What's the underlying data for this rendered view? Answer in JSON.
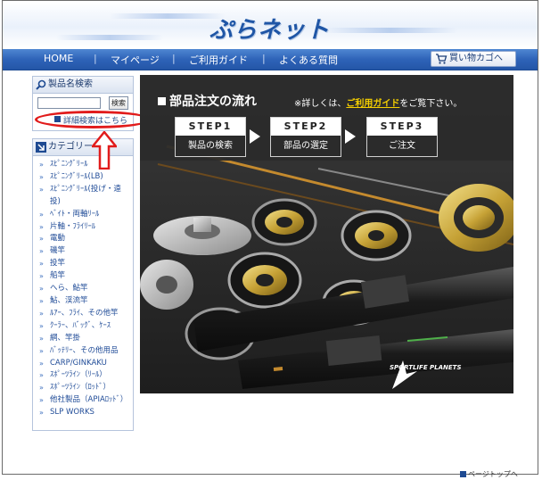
{
  "header": {
    "logo_text": "ぷらネット"
  },
  "nav": {
    "items": [
      {
        "label": "HOME"
      },
      {
        "label": "マイページ"
      },
      {
        "label": "ご利用ガイド"
      },
      {
        "label": "よくある質問"
      }
    ],
    "separator": "|",
    "cart_button": "買い物カゴへ"
  },
  "sidebar": {
    "search": {
      "title": "製品名検索",
      "input_value": "",
      "button_label": "検索",
      "advanced_link": "詳細検索はこちら"
    },
    "categories": {
      "title": "カテゴリー",
      "chevron": "»",
      "items": [
        {
          "label": "ｽﾋﾟﾆﾝｸﾞﾘｰﾙ"
        },
        {
          "label": "ｽﾋﾟﾆﾝｸﾞﾘｰﾙ(LB)"
        },
        {
          "label": "ｽﾋﾟﾆﾝｸﾞﾘｰﾙ(投げ・遠投)"
        },
        {
          "label": "ﾍﾞｲﾄ・両軸ﾘｰﾙ"
        },
        {
          "label": "片軸・ﾌﾗｲﾘｰﾙ"
        },
        {
          "label": "電動"
        },
        {
          "label": "磯竿"
        },
        {
          "label": "投竿"
        },
        {
          "label": "船竿"
        },
        {
          "label": "へら、鮎竿"
        },
        {
          "label": "鮎、渓流竿"
        },
        {
          "label": "ﾙｱｰ、ﾌﾗｲ、その他竿"
        },
        {
          "label": "ｸｰﾗｰ、ﾊﾞｯｸﾞ、ｹｰｽ"
        },
        {
          "label": "網、竿掛"
        },
        {
          "label": "ﾊﾞｯﾃﾘｰ、その他用品"
        },
        {
          "label": "CARP/GINKAKU"
        },
        {
          "label": "ｽﾎﾟｰﾂﾗｲﾝ（ﾘｰﾙ）"
        },
        {
          "label": "ｽﾎﾟｰﾂﾗｲﾝ（ﾛｯﾄﾞ）"
        },
        {
          "label": "他社製品（APIAﾛｯﾄﾞ）"
        },
        {
          "label": "SLP WORKS"
        }
      ]
    }
  },
  "banner": {
    "title": "部品注文の流れ",
    "note_prefix": "※詳しくは、",
    "note_link": "ご利用ガイド",
    "note_suffix": "をご覧下さい。",
    "steps": [
      {
        "label": "STEP1",
        "text": "製品の検索"
      },
      {
        "label": "STEP2",
        "text": "部品の選定"
      },
      {
        "label": "STEP3",
        "text": "ご注文"
      }
    ],
    "footer_logo": "SPORTLIFE PLANETS"
  },
  "footer": {
    "page_top": "ページトップへ"
  },
  "colors": {
    "nav_blue": "#2e63b8",
    "annotation_red": "#e11b1b",
    "highlight_yellow": "#f6d000"
  }
}
